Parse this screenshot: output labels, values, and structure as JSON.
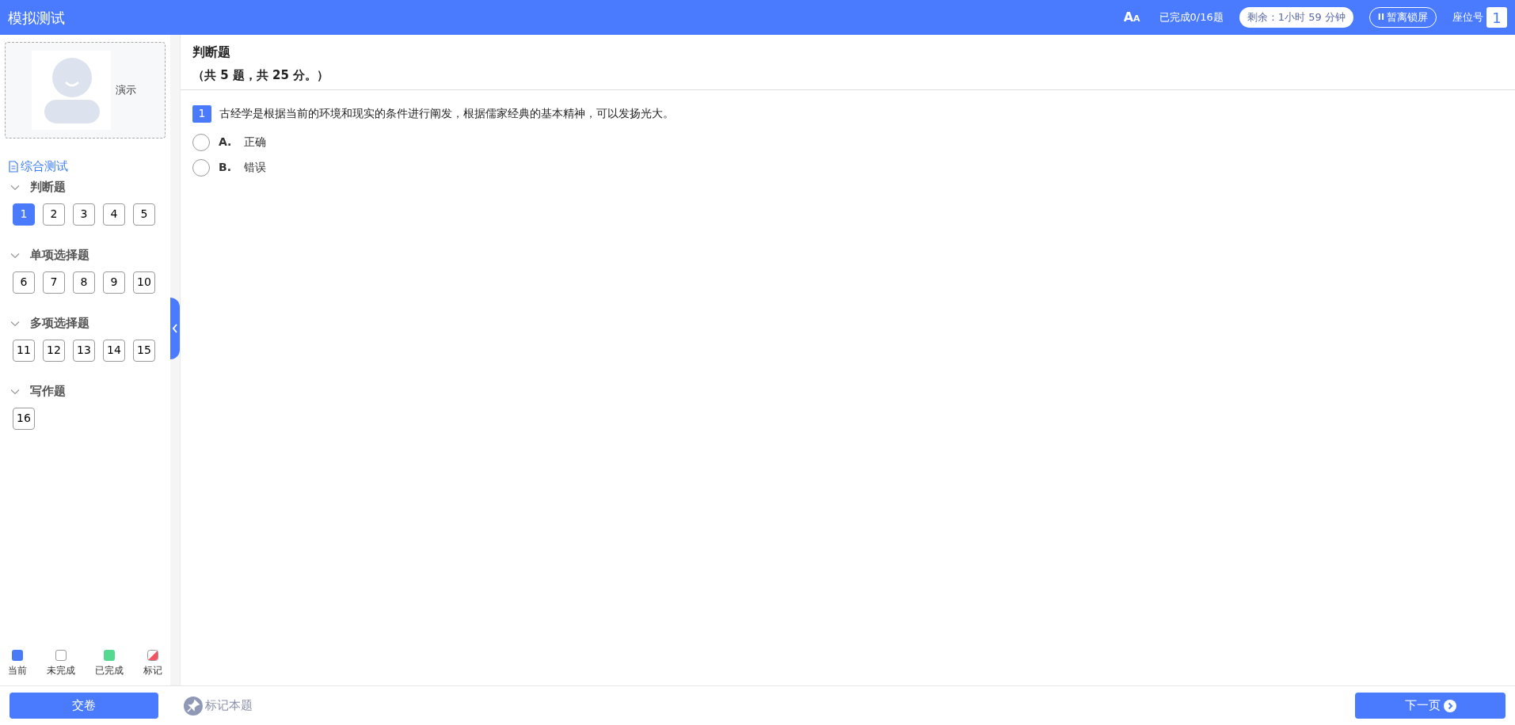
{
  "header": {
    "title": "模拟测试",
    "font_size_large": "A",
    "font_size_small": "A",
    "progress": "已完成0/16题",
    "remaining": "剩余：1小时 59 分钟",
    "lock_button": "暂离锁屏",
    "lock_icon": "II",
    "seat_label": "座位号",
    "seat_number": "1"
  },
  "profile": {
    "name": "演示"
  },
  "paper": {
    "title": "综合测试"
  },
  "sections": [
    {
      "title": "判断题",
      "expanded": true,
      "questions": [
        {
          "number": "1",
          "selected": true
        },
        {
          "number": "2",
          "selected": false
        },
        {
          "number": "3",
          "selected": false
        },
        {
          "number": "4",
          "selected": false
        },
        {
          "number": "5",
          "selected": false
        }
      ]
    },
    {
      "title": "单项选择题",
      "expanded": true,
      "questions": [
        {
          "number": "6",
          "selected": false
        },
        {
          "number": "7",
          "selected": false
        },
        {
          "number": "8",
          "selected": false
        },
        {
          "number": "9",
          "selected": false
        },
        {
          "number": "10",
          "selected": false
        }
      ]
    },
    {
      "title": "多项选择题",
      "expanded": true,
      "questions": [
        {
          "number": "11",
          "selected": false
        },
        {
          "number": "12",
          "selected": false
        },
        {
          "number": "13",
          "selected": false
        },
        {
          "number": "14",
          "selected": false
        },
        {
          "number": "15",
          "selected": false
        }
      ]
    },
    {
      "title": "写作题",
      "expanded": true,
      "questions": [
        {
          "number": "16",
          "selected": false
        }
      ]
    }
  ],
  "legend": [
    {
      "label": "当前",
      "kind": "current",
      "color": "#4a7bf7"
    },
    {
      "label": "未完成",
      "kind": "todo",
      "color": "#ffffff"
    },
    {
      "label": "已完成",
      "kind": "done",
      "color": "#55d88f"
    },
    {
      "label": "标记",
      "kind": "marked",
      "color": "#f5535f"
    }
  ],
  "main": {
    "section_title": "判断题",
    "section_summary": "（共 5 题，共 25 分。）",
    "question": {
      "number": "1",
      "text": "古经学是根据当前的环境和现实的条件进行阐发，根据儒家经典的基本精神，可以发扬光大。",
      "options": [
        {
          "letter": "A.",
          "text": "正确",
          "selected": false
        },
        {
          "letter": "B.",
          "text": "错误",
          "selected": false
        }
      ]
    }
  },
  "footer": {
    "submit": "交卷",
    "mark": "标记本题",
    "next": "下一页"
  }
}
